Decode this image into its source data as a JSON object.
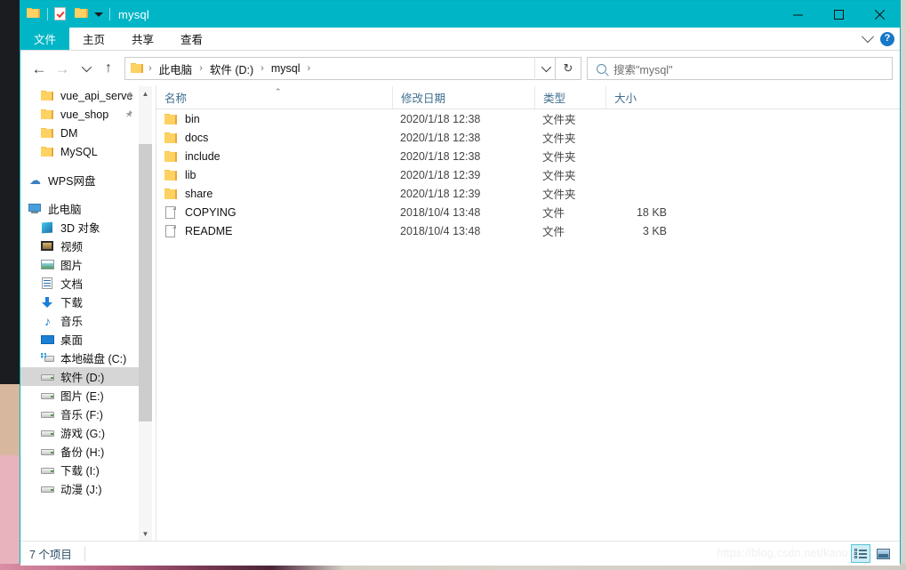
{
  "window": {
    "title": "mysql",
    "quick_access": [
      {
        "name": "folder-icon",
        "label": "资源管理器"
      },
      {
        "name": "properties-icon",
        "label": "属性"
      },
      {
        "name": "new-folder-icon",
        "label": "新建文件夹"
      },
      {
        "name": "customize-caret-icon",
        "label": "自定义快速访问工具栏"
      }
    ],
    "controls": {
      "minimize": "最小化",
      "maximize": "最大化",
      "close": "关闭"
    },
    "accent_color": "#00b6c6"
  },
  "ribbon": {
    "tabs": [
      {
        "label": "文件",
        "active": true
      },
      {
        "label": "主页",
        "active": false
      },
      {
        "label": "共享",
        "active": false
      },
      {
        "label": "查看",
        "active": false
      }
    ],
    "expand_label": "展开功能区",
    "help_label": "?"
  },
  "navigation": {
    "back": "←",
    "forward": "→",
    "recent": "最近使用的位置",
    "up": "↑",
    "breadcrumb": [
      "此电脑",
      "软件 (D:)",
      "mysql"
    ],
    "breadcrumb_separator": "›",
    "dropdown_label": "以前的位置",
    "refresh": "↻",
    "refresh_label": "刷新"
  },
  "search": {
    "placeholder": "搜索\"mysql\"",
    "icon": "search-icon"
  },
  "sidebar": {
    "items": [
      {
        "label": "vue_api_serve",
        "icon": "folder-icon",
        "indent": 1,
        "pinned": true,
        "selected": false
      },
      {
        "label": "vue_shop",
        "icon": "folder-icon",
        "indent": 1,
        "pinned": true,
        "selected": false
      },
      {
        "label": "DM",
        "icon": "folder-icon",
        "indent": 1,
        "pinned": false,
        "selected": false
      },
      {
        "label": "MySQL",
        "icon": "folder-icon",
        "indent": 1,
        "pinned": false,
        "selected": false
      },
      {
        "gap": true
      },
      {
        "label": "WPS网盘",
        "icon": "cloud-icon",
        "indent": 0,
        "pinned": false,
        "selected": false
      },
      {
        "gap": true
      },
      {
        "label": "此电脑",
        "icon": "computer-icon",
        "indent": 0,
        "pinned": false,
        "selected": false
      },
      {
        "label": "3D 对象",
        "icon": "3d-objects-icon",
        "indent": 1,
        "pinned": false,
        "selected": false
      },
      {
        "label": "视频",
        "icon": "videos-icon",
        "indent": 1,
        "pinned": false,
        "selected": false
      },
      {
        "label": "图片",
        "icon": "pictures-icon",
        "indent": 1,
        "pinned": false,
        "selected": false
      },
      {
        "label": "文档",
        "icon": "documents-icon",
        "indent": 1,
        "pinned": false,
        "selected": false
      },
      {
        "label": "下载",
        "icon": "downloads-icon",
        "indent": 1,
        "pinned": false,
        "selected": false
      },
      {
        "label": "音乐",
        "icon": "music-icon",
        "indent": 1,
        "pinned": false,
        "selected": false
      },
      {
        "label": "桌面",
        "icon": "desktop-icon",
        "indent": 1,
        "pinned": false,
        "selected": false
      },
      {
        "label": "本地磁盘 (C:)",
        "icon": "system-drive-icon",
        "indent": 1,
        "pinned": false,
        "selected": false
      },
      {
        "label": "软件 (D:)",
        "icon": "drive-icon",
        "indent": 1,
        "pinned": false,
        "selected": true
      },
      {
        "label": "图片 (E:)",
        "icon": "drive-icon",
        "indent": 1,
        "pinned": false,
        "selected": false
      },
      {
        "label": "音乐 (F:)",
        "icon": "drive-icon",
        "indent": 1,
        "pinned": false,
        "selected": false
      },
      {
        "label": "游戏 (G:)",
        "icon": "drive-icon",
        "indent": 1,
        "pinned": false,
        "selected": false
      },
      {
        "label": "备份 (H:)",
        "icon": "drive-icon",
        "indent": 1,
        "pinned": false,
        "selected": false
      },
      {
        "label": "下载 (I:)",
        "icon": "drive-icon",
        "indent": 1,
        "pinned": false,
        "selected": false
      },
      {
        "label": "动漫 (J:)",
        "icon": "drive-icon",
        "indent": 1,
        "pinned": false,
        "selected": false
      }
    ],
    "pin_glyph": "📌"
  },
  "file_list": {
    "columns": [
      {
        "key": "name",
        "label": "名称",
        "sorted": "asc"
      },
      {
        "key": "date",
        "label": "修改日期",
        "sorted": null
      },
      {
        "key": "type",
        "label": "类型",
        "sorted": null
      },
      {
        "key": "size",
        "label": "大小",
        "sorted": null
      }
    ],
    "sort_caret": "⌃",
    "rows": [
      {
        "name": "bin",
        "date": "2020/1/18 12:38",
        "type": "文件夹",
        "size": "",
        "icon": "folder"
      },
      {
        "name": "docs",
        "date": "2020/1/18 12:38",
        "type": "文件夹",
        "size": "",
        "icon": "folder"
      },
      {
        "name": "include",
        "date": "2020/1/18 12:38",
        "type": "文件夹",
        "size": "",
        "icon": "folder"
      },
      {
        "name": "lib",
        "date": "2020/1/18 12:39",
        "type": "文件夹",
        "size": "",
        "icon": "folder"
      },
      {
        "name": "share",
        "date": "2020/1/18 12:39",
        "type": "文件夹",
        "size": "",
        "icon": "folder"
      },
      {
        "name": "COPYING",
        "date": "2018/10/4 13:48",
        "type": "文件",
        "size": "18 KB",
        "icon": "file"
      },
      {
        "name": "README",
        "date": "2018/10/4 13:48",
        "type": "文件",
        "size": "3 KB",
        "icon": "file"
      }
    ]
  },
  "status": {
    "item_count": "7 个项目",
    "views": [
      {
        "name": "details-view",
        "label": "详细信息",
        "active": true
      },
      {
        "name": "large-icons-view",
        "label": "大图标",
        "active": false
      }
    ]
  },
  "watermark": "https://blog.csdn.net/kano"
}
